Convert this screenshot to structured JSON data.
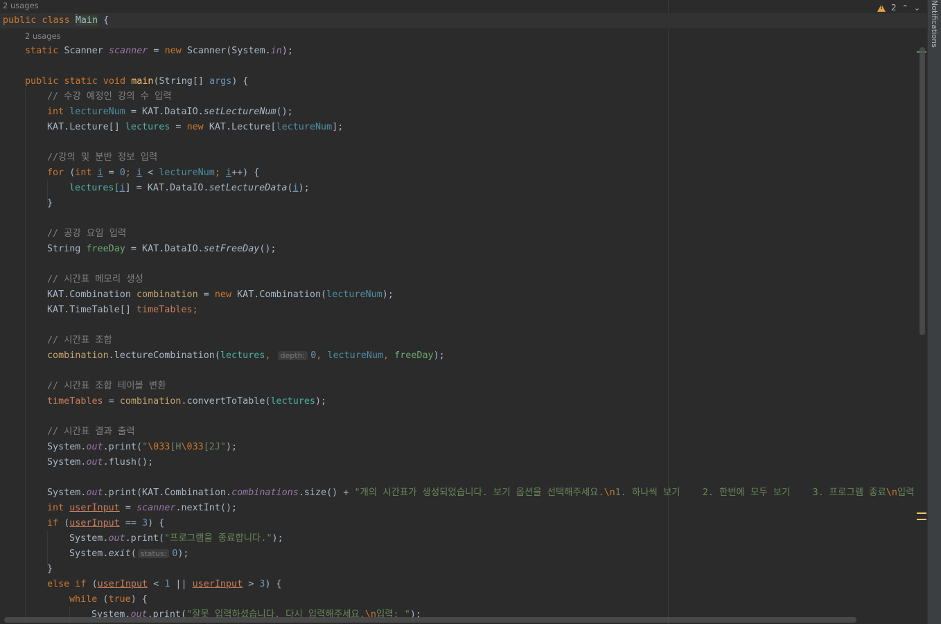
{
  "editor": {
    "notifications_label": "Notifications",
    "inspections": {
      "warning_count": "2"
    },
    "usages_class": "2 usages",
    "usages_field": "2 usages",
    "hint_depth": "depth:",
    "hint_status": "status:",
    "code": {
      "l1a": "public class ",
      "l1b": "Main",
      "l1c": " {",
      "l2a": "static ",
      "l2b": "Scanner ",
      "l2c": "scanner",
      "l2d": " = ",
      "l2e": "new ",
      "l2f": "Scanner(System.",
      "l2g": "in",
      "l2h": ");",
      "l3a": "public static void ",
      "l3b": "main",
      "l3c": "(String[] ",
      "l3d": "args",
      "l3e": ") {",
      "l4": "// 수강 예정인 강의 수 입력",
      "l5a": "int ",
      "l5b": "lectureNum",
      "l5c": " = KAT.DataIO.",
      "l5d": "setLectureNum",
      "l5e": "();",
      "l6a": "KAT.Lecture[] ",
      "l6b": "lectures",
      "l6c": " = ",
      "l6d": "new ",
      "l6e": "KAT.Lecture[",
      "l6f": "lectureNum",
      "l6g": "];",
      "l7": "//강의 및 분반 정보 입력",
      "l8a": "for ",
      "l8b": "(",
      "l8c": "int ",
      "l8d": "i",
      "l8e": " = ",
      "l8f": "0",
      "l8g": "; ",
      "l8h": "i",
      "l8i": " < ",
      "l8j": "lectureNum",
      "l8k": "; ",
      "l8l": "i",
      "l8m": "++) {",
      "l9a": "lectures[",
      "l9b": "i",
      "l9c": "] = KAT.DataIO.",
      "l9d": "setLectureData",
      "l9e": "(",
      "l9f": "i",
      "l9g": ");",
      "l10": "}",
      "l11": "// 공강 요일 입력",
      "l12a": "String ",
      "l12b": "freeDay",
      "l12c": " = KAT.DataIO.",
      "l12d": "setFreeDay",
      "l12e": "();",
      "l13": "// 시간표 메모리 생성",
      "l14a": "KAT.Combination ",
      "l14b": "combination",
      "l14c": " = ",
      "l14d": "new ",
      "l14e": "KAT.Combination(",
      "l14f": "lectureNum",
      "l14g": ");",
      "l15a": "KAT.TimeTable[] ",
      "l15b": "timeTables",
      "l15c": ";",
      "l16": "// 시간표 조합",
      "l17a": "combination",
      "l17b": ".lectureCombination(",
      "l17c": "lectures",
      "l17d": ",",
      "l17e": "0",
      "l17f": ", ",
      "l17g": "lectureNum",
      "l17h": ", ",
      "l17i": "freeDay",
      "l17j": ");",
      "l18": "// 시간표 조합 테이블 변환",
      "l19a": "timeTables",
      "l19b": " = ",
      "l19c": "combination",
      "l19d": ".convertToTable(",
      "l19e": "lectures",
      "l19f": ");",
      "l20": "// 시간표 결과 출력",
      "l21a": "System.",
      "l21b": "out",
      "l21c": ".print(",
      "l21d": "\"",
      "l21e": "\\033",
      "l21f": "[H",
      "l21g": "\\033",
      "l21h": "[2J\"",
      "l21i": ");",
      "l22a": "System.",
      "l22b": "out",
      "l22c": ".flush();",
      "l23a": "System.",
      "l23b": "out",
      "l23c": ".print(KAT.Combination.",
      "l23d": "combinations",
      "l23e": ".size() + ",
      "l23f": "\"개의 시간표가 생성되었습니다. 보기 옵션을 선택해주세요.",
      "l23g": "\\n",
      "l23h": "1. 하나씩 보기    2. 한번에 모두 보기    3. 프로그램 종료",
      "l23i": "\\n",
      "l23j": "입력",
      "l24a": "int ",
      "l24b": "userInput",
      "l24c": " = ",
      "l24d": "scanner",
      "l24e": ".nextInt();",
      "l25a": "if ",
      "l25b": "(",
      "l25c": "userInput",
      "l25d": " == ",
      "l25e": "3",
      "l25f": ") {",
      "l26a": "System.",
      "l26b": "out",
      "l26c": ".print(",
      "l26d": "\"프로그램을 종료합니다.\"",
      "l26e": ");",
      "l27a": "System.",
      "l27b": "exit",
      "l27c": "(",
      "l27d": "0",
      "l27e": ");",
      "l28": "}",
      "l29a": "else if ",
      "l29b": "(",
      "l29c": "userInput",
      "l29d": " < ",
      "l29e": "1",
      "l29f": " || ",
      "l29g": "userInput",
      "l29h": " > ",
      "l29i": "3",
      "l29j": ") {",
      "l30a": "while ",
      "l30b": "(",
      "l30c": "true",
      "l30d": ") {",
      "l31a": "System.",
      "l31b": "out",
      "l31c": ".print(",
      "l31d": "\"잘못 입력하셨습니다. 다시 입력해주세요.",
      "l31e": "\\n",
      "l31f": "입력: \"",
      "l31g": ");"
    }
  }
}
